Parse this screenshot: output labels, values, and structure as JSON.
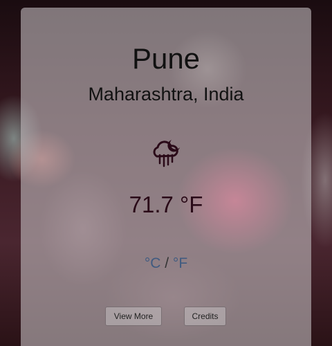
{
  "location": {
    "city": "Pune",
    "region": "Maharashtra, India"
  },
  "weather": {
    "icon": "cloud-rain-moon-icon",
    "temperature": "71.7 °F"
  },
  "units": {
    "celsius": "°C",
    "separator": "/",
    "fahrenheit": "°F"
  },
  "buttons": {
    "view_more": "View More",
    "credits": "Credits"
  },
  "colors": {
    "card_bg": "#bcb8bc",
    "temperature": "#2a0a18",
    "unit_toggle": "#3f5a80",
    "icon": "#2a0a18"
  }
}
